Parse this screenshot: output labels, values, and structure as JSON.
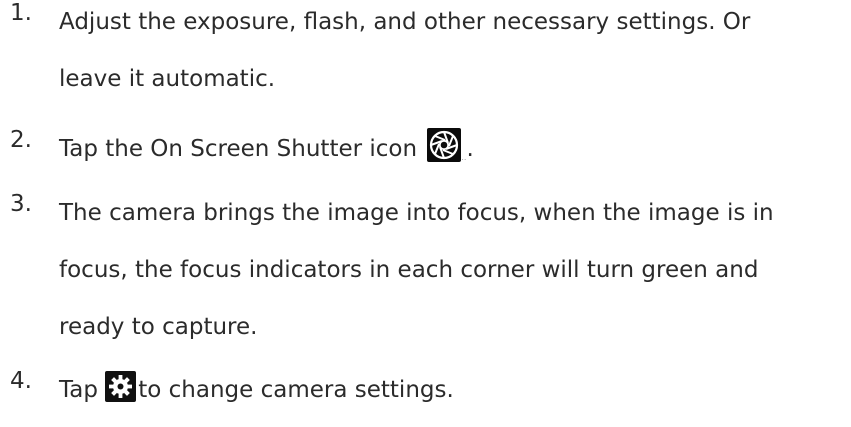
{
  "steps": [
    {
      "number": "1.",
      "lines": [
        "Adjust the exposure, flash, and other necessary settings. Or",
        "leave it automatic."
      ]
    },
    {
      "number": "2.",
      "before_icon": "Tap the On Screen Shutter icon",
      "icon": "shutter-icon",
      "after_icon": "."
    },
    {
      "number": "3.",
      "lines": [
        "The camera brings the image into focus, when the image is in",
        "focus, the focus indicators in each corner will turn green and",
        "ready to capture."
      ]
    },
    {
      "number": "4.",
      "before_icon": "Tap",
      "icon": "gear-icon",
      "after_icon": "to change camera settings."
    }
  ]
}
